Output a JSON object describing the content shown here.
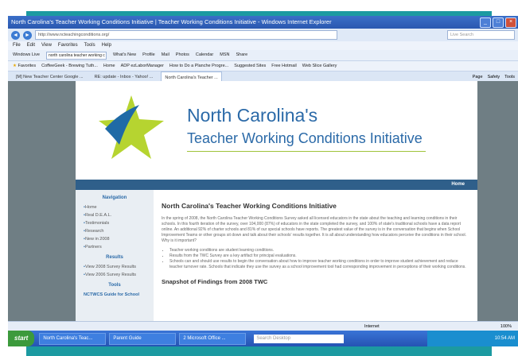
{
  "browser": {
    "title": "North Carolina's Teacher Working Conditions Initiative | Teacher Working Conditions Initiative - Windows Internet Explorer",
    "address": "http://www.ncteachingconditions.org/",
    "search_placeholder": "Live Search",
    "menu": [
      "File",
      "Edit",
      "View",
      "Favorites",
      "Tools",
      "Help"
    ],
    "toolbar": {
      "windows_live": "Windows Live",
      "input_value": "north carolina teacher working c",
      "items": [
        "What's New",
        "Profile",
        "Mail",
        "Photos",
        "Calendar",
        "MSN",
        "Share"
      ]
    },
    "favorites": {
      "label": "Favorites",
      "items": [
        "CoffeeGeek - Brewing Tuth...",
        "Home",
        "ADP ezLaborManager",
        "How to Do a Planche Progre...",
        "Suggested Sites",
        "Free Hotmail",
        "Web Slice Gallery"
      ]
    },
    "tabs": [
      "[M] New Teacher Center Google ...",
      "RE: update - Inbox - Yahoo! ...",
      "North Carolina's Teacher ..."
    ],
    "tools": [
      "Page",
      "Safety",
      "Tools"
    ]
  },
  "site": {
    "title_line1": "North Carolina's",
    "title_line2": "Teacher Working Conditions Initiative",
    "home_link": "Home",
    "sidebar": {
      "nav_heading": "Navigation",
      "nav_items": [
        "Home",
        "Real D.E.A.L.",
        "Testimonials",
        "Research",
        "New in 2008",
        "Partners"
      ],
      "results_heading": "Results",
      "results_items": [
        "View 2008 Survey Results",
        "View 2006 Survey Results"
      ],
      "tools_heading": "Tools",
      "tools_items": [
        "NCTWCS Guide for School"
      ]
    },
    "main": {
      "heading": "North Carolina's Teacher Working Conditions Initiative",
      "paragraph": "In the spring of 2008, the North Carolina Teacher Working Conditions Survey asked all licensed educators in the state about the teaching and learning conditions in their schools. In this fourth iteration of the survey, over 104,000 (87%) of educators in the state completed the survey, and 100% of state's traditional schools have a data report online. An additional 92% of charter schools and 81% of our special schools have reports. The greatest value of the survey is in the conversation that begins when School Improvement Teams or other groups sit down and talk about their schools' results together. It is all about understanding how educators perceive the conditions in their school. Why is it important?",
      "bullets": [
        "Teacher working conditions are student learning conditions.",
        "Results from the TWC Survey are a key artifact for principal evaluations.",
        "Schools can and should use results to begin the conversation about how to improve teacher working conditions in order to improve student achievement and reduce teacher turnover rate. Schools that indicate they use the survey as a school improvement tool had corresponding improvement in perceptions of their working conditions."
      ],
      "subheading": "Snapshot of Findings from 2008 TWC"
    }
  },
  "status": {
    "zone": "Internet",
    "zoom": "100%"
  },
  "taskbar": {
    "start": "start",
    "tasks": [
      "North Carolina's Teac...",
      "Parent Guide",
      "2 Microsoft Office ..."
    ],
    "search_placeholder": "Search Desktop",
    "clock": "10:54 AM"
  }
}
